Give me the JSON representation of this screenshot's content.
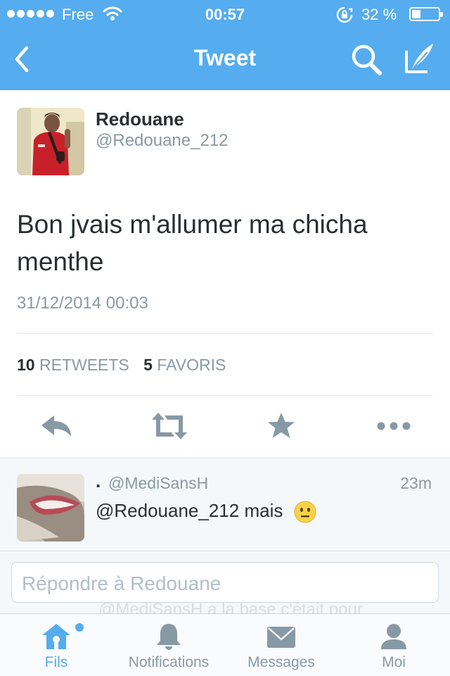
{
  "status_bar": {
    "carrier": "Free",
    "time": "00:57",
    "battery": "32 %"
  },
  "nav": {
    "title": "Tweet",
    "back_icon": "chevron-left-icon",
    "search_icon": "search-icon",
    "compose_icon": "compose-quill-icon"
  },
  "tweet": {
    "author_name": "Redouane",
    "author_handle": "@Redouane_212",
    "text": "Bon jvais m'allumer ma chicha menthe",
    "date": "31/12/2014 00:03",
    "retweet_count": "10",
    "retweet_label": "RETWEETS",
    "favorite_count": "5",
    "favorite_label": "FAVORIS"
  },
  "actions": [
    "reply-icon",
    "retweet-icon",
    "favorite-star-icon",
    "more-dots-icon"
  ],
  "reply": {
    "name": ".",
    "handle": "@MediSansH",
    "time": "23m",
    "text": "@Redouane_212 mais",
    "emoji": "neutral-face-emoji"
  },
  "compose": {
    "placeholder": "Répondre à Redouane",
    "ghost_text": "@MediSansH a la base c'était pour"
  },
  "tabbar": {
    "tabs": [
      {
        "label": "Fils",
        "icon": "home-icon",
        "active": true,
        "notification_dot": true
      },
      {
        "label": "Notifications",
        "icon": "bell-icon",
        "active": false
      },
      {
        "label": "Messages",
        "icon": "envelope-icon",
        "active": false
      },
      {
        "label": "Moi",
        "icon": "profile-icon",
        "active": false
      }
    ]
  },
  "colors": {
    "brand": "#55acee",
    "text": "#292f33",
    "secondary": "#8899a6",
    "divider": "#e1e8ed",
    "reply_background": "#f5f8fa"
  }
}
